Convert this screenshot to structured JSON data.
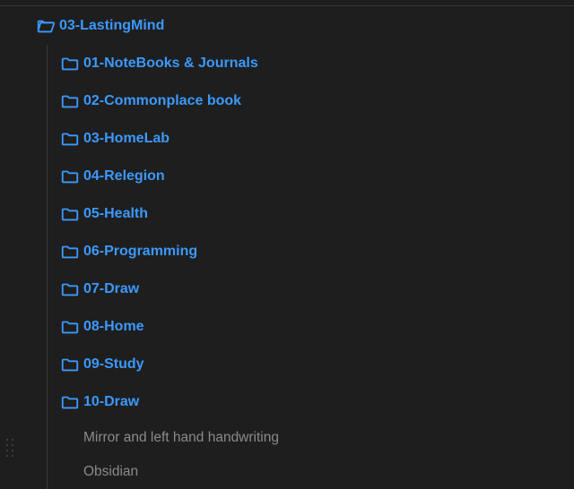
{
  "colors": {
    "accent": "#3b99fc",
    "muted": "#8a8a8a",
    "background": "#1e1e1e"
  },
  "tree": {
    "root": {
      "label": "03-LastingMind",
      "icon": "folder-open-icon",
      "expanded": true
    },
    "folders": [
      {
        "label": "01-NoteBooks & Journals"
      },
      {
        "label": "02-Commonplace book"
      },
      {
        "label": "03-HomeLab"
      },
      {
        "label": "04-Relegion"
      },
      {
        "label": "05-Health"
      },
      {
        "label": "06-Programming"
      },
      {
        "label": "07-Draw"
      },
      {
        "label": "08-Home"
      },
      {
        "label": "09-Study"
      },
      {
        "label": "10-Draw"
      }
    ],
    "files": [
      {
        "label": "Mirror and left hand handwriting"
      },
      {
        "label": "Obsidian"
      }
    ]
  }
}
